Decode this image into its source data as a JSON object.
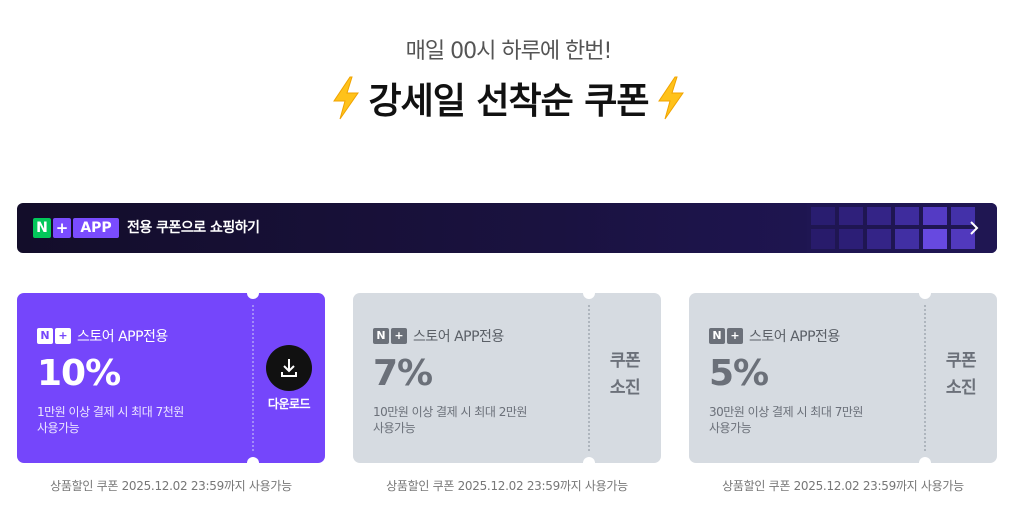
{
  "header": {
    "subtitle": "매일 00시 하루에 한번!",
    "title": "강세일 선착순 쿠폰"
  },
  "app_banner": {
    "badge_n": "N",
    "badge_plus": "+",
    "badge_app": "APP",
    "text": "전용 쿠폰으로 쇼핑하기"
  },
  "coupons": [
    {
      "brand_n": "N",
      "brand_plus": "+",
      "brand_label": "스토어 APP전용",
      "discount": "10%",
      "condition_line1": "1만원 이상 결제 시 최대 7천원",
      "condition_line2": "사용가능",
      "status": "download",
      "action_label": "다운로드",
      "validity": "상품할인 쿠폰 2025.12.02 23:59까지 사용가능"
    },
    {
      "brand_n": "N",
      "brand_plus": "+",
      "brand_label": "스토어 APP전용",
      "discount": "7%",
      "condition_line1": "10만원 이상 결제 시 최대 2만원",
      "condition_line2": "사용가능",
      "status": "soldout",
      "soldout_line1": "쿠폰",
      "soldout_line2": "소진",
      "validity": "상품할인 쿠폰 2025.12.02 23:59까지 사용가능"
    },
    {
      "brand_n": "N",
      "brand_plus": "+",
      "brand_label": "스토어 APP전용",
      "discount": "5%",
      "condition_line1": "30만원 이상 결제 시 최대 7만원",
      "condition_line2": "사용가능",
      "status": "soldout",
      "soldout_line1": "쿠폰",
      "soldout_line2": "소진",
      "validity": "상품할인 쿠폰 2025.12.02 23:59까지 사용가능"
    }
  ],
  "colors": {
    "accent": "#7546fb",
    "naver_green": "#03c75a",
    "soldout_card": "#d6dbe1",
    "banner_bg": "#1a1240"
  },
  "icons": [
    "lightning-icon",
    "chevron-right-icon",
    "download-icon"
  ]
}
